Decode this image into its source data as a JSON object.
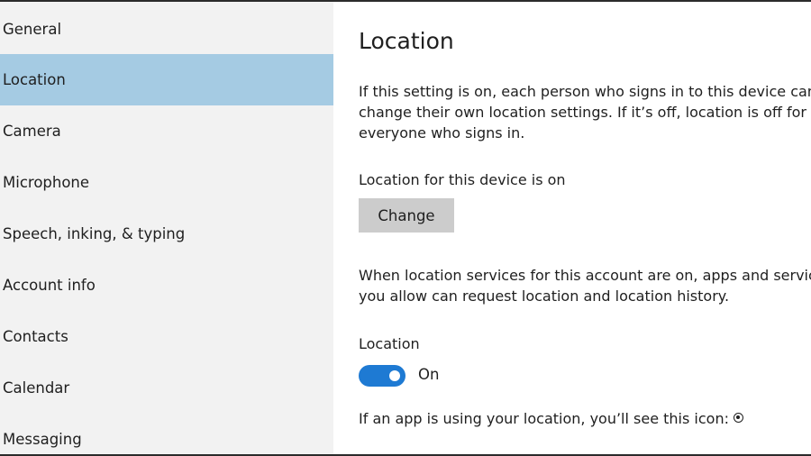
{
  "sidebar": {
    "items": [
      {
        "label": "General"
      },
      {
        "label": "Location",
        "selected": true
      },
      {
        "label": "Camera"
      },
      {
        "label": "Microphone"
      },
      {
        "label": "Speech, inking, & typing"
      },
      {
        "label": "Account info"
      },
      {
        "label": "Contacts"
      },
      {
        "label": "Calendar"
      },
      {
        "label": "Messaging"
      }
    ],
    "selected_color": "#a5cbe3",
    "background_color": "#f2f2f2"
  },
  "main": {
    "title": "Location",
    "intro_lines": [
      "If this setting is on, each person who signs in to this device can",
      "change their own location settings. If it’s off, location is off for",
      "everyone who signs in."
    ],
    "device_status": "Location for this device is on",
    "change_button_label": "Change",
    "account_lines": [
      "When location services for this account are on, apps and services",
      "you allow can request location and location history."
    ],
    "location_toggle": {
      "label": "Location",
      "state_text": "On",
      "on": true,
      "color": "#1e7ad3"
    },
    "icon_note": "If an app is using your location, you’ll see this icon:",
    "icon_note_icon": "location-in-use-icon"
  }
}
